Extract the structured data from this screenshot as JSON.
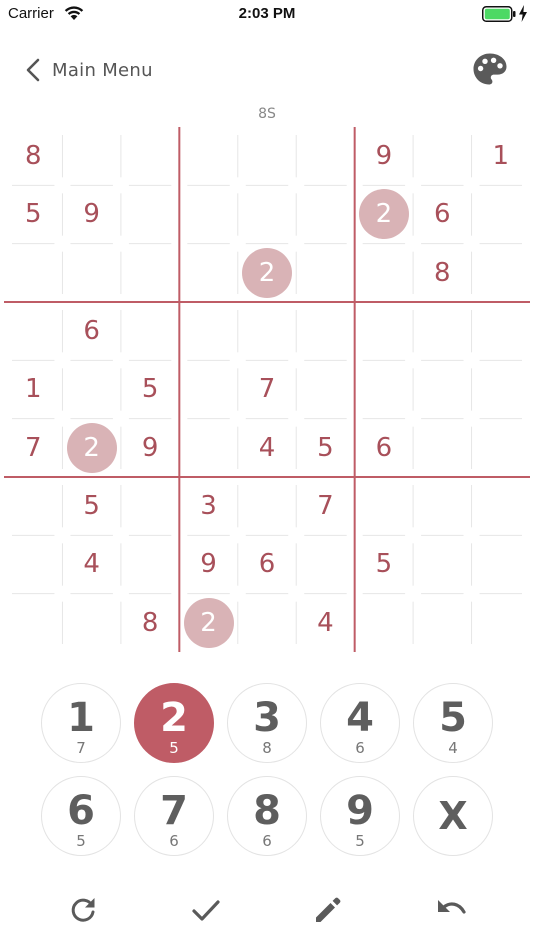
{
  "status_bar": {
    "carrier": "Carrier",
    "time": "2:03 PM"
  },
  "nav": {
    "back_label": "Main Menu"
  },
  "puzzle": {
    "label": "8S"
  },
  "colors": {
    "accent": "#bf5c66",
    "digit": "#a8505a",
    "highlight": "#d9b3b6",
    "battery": "#4cd964"
  },
  "board": {
    "rows": [
      [
        "8",
        "",
        "",
        "",
        "",
        "",
        "9",
        "",
        "1"
      ],
      [
        "5",
        "9",
        "",
        "",
        "",
        "",
        "2",
        "6",
        ""
      ],
      [
        "",
        "",
        "",
        "",
        "2",
        "",
        "",
        "8",
        ""
      ],
      [
        "",
        "6",
        "",
        "",
        "",
        "",
        "",
        "",
        ""
      ],
      [
        "1",
        "",
        "5",
        "",
        "7",
        "",
        "",
        "",
        ""
      ],
      [
        "7",
        "2",
        "9",
        "",
        "4",
        "5",
        "6",
        "",
        ""
      ],
      [
        "",
        "5",
        "",
        "3",
        "",
        "7",
        "",
        "",
        ""
      ],
      [
        "",
        "4",
        "",
        "9",
        "6",
        "",
        "5",
        "",
        ""
      ],
      [
        "",
        "",
        "8",
        "2",
        "",
        "4",
        "",
        "",
        ""
      ]
    ],
    "highlighted_digit": "2"
  },
  "number_pad": [
    {
      "digit": "1",
      "count": "7",
      "active": false
    },
    {
      "digit": "2",
      "count": "5",
      "active": true
    },
    {
      "digit": "3",
      "count": "8",
      "active": false
    },
    {
      "digit": "4",
      "count": "6",
      "active": false
    },
    {
      "digit": "5",
      "count": "4",
      "active": false
    },
    {
      "digit": "6",
      "count": "5",
      "active": false
    },
    {
      "digit": "7",
      "count": "6",
      "active": false
    },
    {
      "digit": "8",
      "count": "6",
      "active": false
    },
    {
      "digit": "9",
      "count": "5",
      "active": false
    },
    {
      "digit": "X",
      "count": "",
      "active": false
    }
  ],
  "toolbar": [
    {
      "name": "restart-icon"
    },
    {
      "name": "checkmark-icon"
    },
    {
      "name": "pencil-icon"
    },
    {
      "name": "undo-icon"
    }
  ]
}
